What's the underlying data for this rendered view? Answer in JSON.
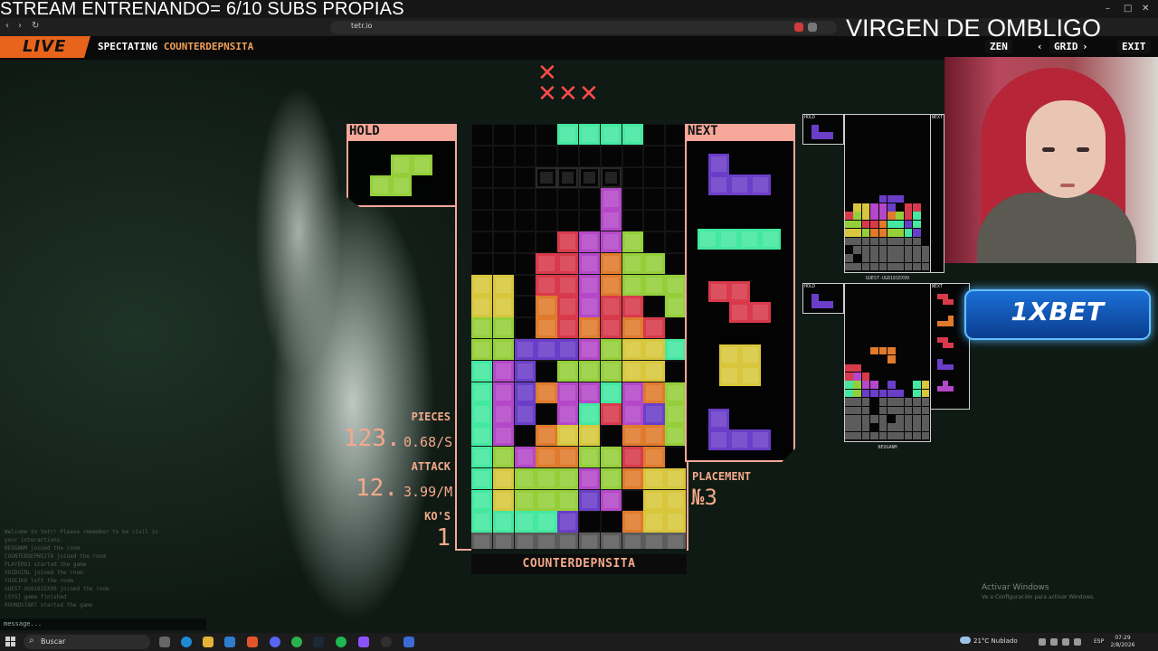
{
  "overlay": {
    "stream_title": "STREAM ENTRENANDO= 6/10 SUBS PROPIAS",
    "streamer_name": "VIRGEN DE OMBLIGO"
  },
  "browser": {
    "url": "tetr.io",
    "nav": {
      "back": "‹",
      "forward": "›",
      "reload": "↻"
    },
    "window_controls": [
      "–",
      "□",
      "✕"
    ]
  },
  "game_bar": {
    "live_label": "LIVE",
    "spectating_label": "SPECTATING",
    "spectating_player": "COUNTERDEPNSITA",
    "zen_label": "ZEN",
    "grid_label": "GRID",
    "exit_label": "EXIT",
    "prev_arrow": "‹",
    "next_arrow": "›"
  },
  "lives": {
    "x_glyph": "✕",
    "count_top": 1,
    "count_bottom": 3
  },
  "hold": {
    "label": "HOLD",
    "piece": "S"
  },
  "next": {
    "label": "NEXT",
    "queue": [
      "J",
      "I",
      "Z",
      "O",
      "J"
    ]
  },
  "board": {
    "player_name": "COUNTERDEPNSITA",
    "cols": 10,
    "colors": {
      "I": "#44e8a0",
      "O": "#d8c63c",
      "T": "#b448c8",
      "S": "#94cf3a",
      "Z": "#d83a4b",
      "L": "#e07a2c",
      "J": "#6a3ec8",
      "G": "#5c5c5c",
      "ghost": "#2a2a2a"
    },
    "rows": [
      "....IIII..",
      "..........",
      "...gggg...",
      "......T...",
      "......T...",
      "....ZTTS..",
      "...ZZTLSS.",
      "OO.ZZTLSSS",
      "OO.LZTZZ.S",
      "SS.LZLZLZ.",
      "SSJJJTSOOI",
      "ITJ.SSSOO.",
      "ITJLTTITLS",
      "ITJ.TIZTJS",
      "IT.LOO.LLS",
      "ISTLLSSZL.",
      "IOSSSTSLOO",
      "IOSSSJT.OO",
      "IIIIJ..LOO",
      "GGGGGGGGGG",
      ".GGGGGGGGG",
      "GGGGGGGG.G",
      "GGGGGG.GGG",
      "GGG.GGGGGG",
      "GGG.GGGGGG",
      "GGGGGG.GGG"
    ]
  },
  "stats": {
    "pieces_label": "PIECES",
    "pieces_count": "123.",
    "pieces_rate": "0.68/S",
    "attack_label": "ATTACK",
    "attack_count": "12.",
    "attack_rate": "3.99/M",
    "kos_label": "KO'S",
    "kos_count": "1",
    "placement_label": "PLACEMENT",
    "placement_value": "№3"
  },
  "chat": {
    "lines": [
      "Welcome to tetr! Please remember to be civil in",
      "your interactions.",
      "NEOGANM joined the room",
      "COUNTERDEPNSITA joined the room",
      "PLAYER01 started the game",
      "VOIDGIRL joined the room",
      "YUSEIKO left the room",
      "GUEST-UG8181EX99 joined the room",
      "[SYS] game finished",
      "ROUNDSTART started the game"
    ],
    "input_placeholder": "message..."
  },
  "opponents": [
    {
      "name": "GUEST-UG8181EX99",
      "hold_label": "HOLD",
      "next_label": "NEXT",
      "hold_piece": "J",
      "next_queue": [
        "L",
        "J",
        "Z",
        "O",
        "S"
      ],
      "rows": [
        "....JJJ...",
        ".OOTTJ.ZZ.",
        "ZSOTTLSZI.",
        "SSZZLIIJI.",
        "OOSLLSSIJ.",
        "GGGGGGGGG.",
        ".GGGGGGGGG",
        "G.GGGGGGGG",
        "GGGGGGGGGG"
      ]
    },
    {
      "name": "NEOGANM",
      "hold_label": "HOLD",
      "next_label": "NEXT",
      "hold_piece": "J",
      "next_queue": [
        "Z",
        "L",
        "Z",
        "J",
        "T"
      ],
      "rows": [
        "...LLL....",
        ".....L....",
        "ZZ........",
        "ZTZ.......",
        "ISTT.J..IO",
        "ISJJJJJ.IO",
        "GGG.GGGGGG",
        "GGG.GGGGGG",
        "GGGGG.GGGG",
        "GGG.GGGGGG",
        "GGGGGGGGGG"
      ]
    }
  ],
  "ad": {
    "brand": "1XBET"
  },
  "windows_watermark": {
    "line1": "Activar Windows",
    "line2": "Ve a Configuración para activar Windows."
  },
  "taskbar": {
    "search_label": "Buscar",
    "weather": "21°C  Nublado",
    "lang": "ESP",
    "time": "07:29",
    "date": "2/8/2026"
  }
}
